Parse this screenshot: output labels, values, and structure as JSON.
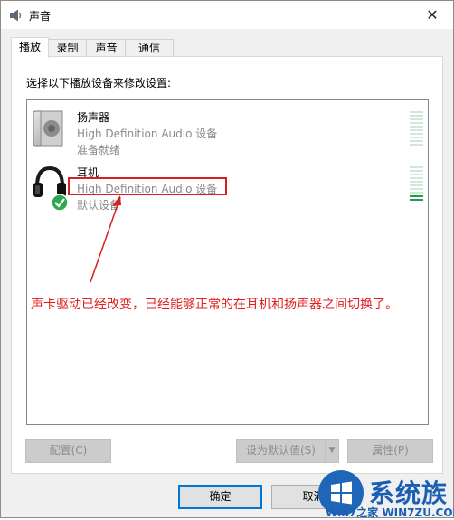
{
  "window": {
    "title": "声音",
    "close_glyph": "✕"
  },
  "tabs": [
    {
      "label": "播放",
      "active": true
    },
    {
      "label": "录制",
      "active": false
    },
    {
      "label": "声音",
      "active": false
    },
    {
      "label": "通信",
      "active": false
    }
  ],
  "panel": {
    "instruction": "选择以下播放设备来修改设置:"
  },
  "devices": [
    {
      "name": "扬声器",
      "description": "High Definition Audio 设备",
      "status": "准备就绪",
      "icon": "speaker-icon",
      "default": false,
      "level": 0.0
    },
    {
      "name": "耳机",
      "description": "High Definition Audio 设备",
      "status": "默认设备",
      "icon": "headphones-icon",
      "default": true,
      "level": 0.15
    }
  ],
  "annotation": {
    "text": "声卡驱动已经改变，已经能够正常的在耳机和扬声器之间切换了。",
    "color": "#e02020"
  },
  "buttons": {
    "configure": "配置(C)",
    "set_default": "设为默认值(S)",
    "properties": "属性(P)",
    "ok": "确定",
    "cancel": "取消"
  },
  "watermark": {
    "main": "系统族",
    "sub": "Win7之家 WIN7ZU.COM"
  },
  "colors": {
    "meter_idle": "#cfe8da",
    "meter_active": "#1e9e4a",
    "default_badge": "#2fa84f",
    "accent": "#0078d7"
  }
}
